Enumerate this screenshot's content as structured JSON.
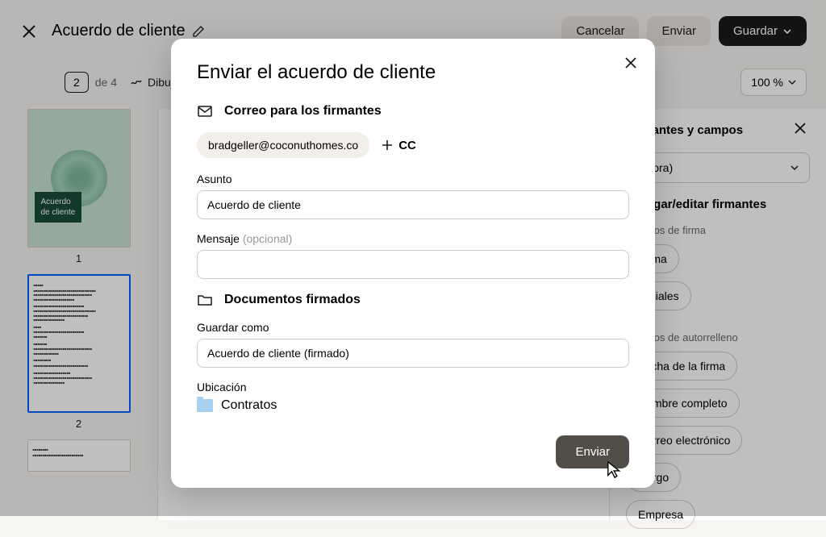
{
  "header": {
    "doc_title": "Acuerdo de cliente",
    "cancel": "Cancelar",
    "send": "Enviar",
    "save": "Guardar"
  },
  "toolbar": {
    "page_current": "2",
    "page_of": "de 4",
    "draw": "Dibujar",
    "zoom": "100 %"
  },
  "thumbnails": {
    "page1_label_line1": "Acuerdo",
    "page1_label_line2": "de cliente",
    "page1_num": "1",
    "page2_num": "2"
  },
  "side_panel": {
    "title": "Firmantes y campos",
    "selector": "(ahora)",
    "add_signers": "Agregar/editar firmantes",
    "sign_fields_head": "Campos de firma",
    "field_signature": "Firma",
    "field_initials": "Iniciales",
    "autofill_head": "Campos de autorrelleno",
    "field_sign_date": "Fecha de la firma",
    "field_full_name": "Nombre completo",
    "field_email": "Correo electrónico",
    "field_position": "Cargo",
    "field_company": "Empresa"
  },
  "modal": {
    "title": "Enviar el acuerdo de cliente",
    "section_email": "Correo para los firmantes",
    "email_chip": "bradgeller@coconuthomes.co",
    "cc": "CC",
    "subject_label": "Asunto",
    "subject_value": "Acuerdo de cliente",
    "message_label": "Mensaje",
    "message_optional": "(opcional)",
    "section_docs": "Documentos firmados",
    "save_as_label": "Guardar como",
    "save_as_value": "Acuerdo de cliente (firmado)",
    "location_label": "Ubicación",
    "location_folder": "Contratos",
    "send_button": "Enviar"
  }
}
